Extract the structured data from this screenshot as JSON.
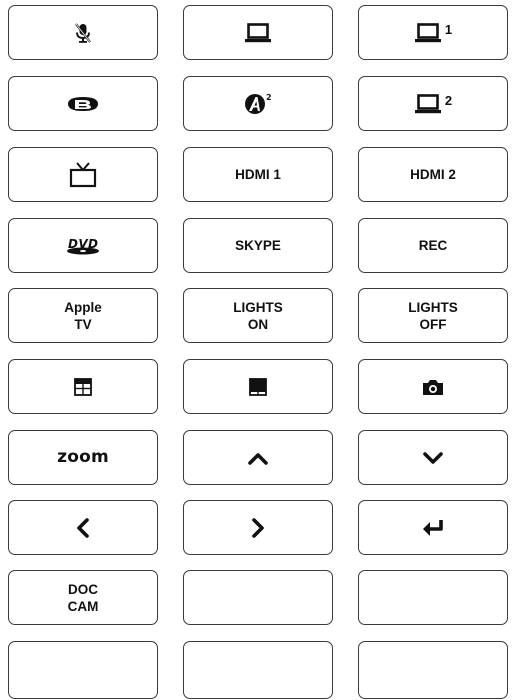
{
  "panel": {
    "buttons": [
      {
        "icon": "mic-muted-icon",
        "label": "",
        "suffix": ""
      },
      {
        "icon": "laptop-icon",
        "label": "",
        "suffix": ""
      },
      {
        "icon": "laptop-icon",
        "label": "",
        "suffix": "1"
      },
      {
        "icon": "bluray-icon",
        "label": "",
        "suffix": ""
      },
      {
        "icon": "airmedia-icon",
        "label": "",
        "suffix": ""
      },
      {
        "icon": "laptop-icon",
        "label": "",
        "suffix": "2"
      },
      {
        "icon": "tv-icon",
        "label": "",
        "suffix": ""
      },
      {
        "icon": "",
        "label": "HDMI 1",
        "suffix": ""
      },
      {
        "icon": "",
        "label": "HDMI 2",
        "suffix": ""
      },
      {
        "icon": "dvd-icon",
        "label": "",
        "suffix": ""
      },
      {
        "icon": "",
        "label": "SKYPE",
        "suffix": ""
      },
      {
        "icon": "",
        "label": "REC",
        "suffix": ""
      },
      {
        "icon": "",
        "label": "Apple\nTV",
        "suffix": ""
      },
      {
        "icon": "",
        "label": "LIGHTS\nON",
        "suffix": ""
      },
      {
        "icon": "",
        "label": "LIGHTS\nOFF",
        "suffix": ""
      },
      {
        "icon": "shade-up-icon",
        "label": "",
        "suffix": ""
      },
      {
        "icon": "shade-down-icon",
        "label": "",
        "suffix": ""
      },
      {
        "icon": "camera-icon",
        "label": "",
        "suffix": ""
      },
      {
        "icon": "zoom-logo",
        "label": "zoom",
        "suffix": ""
      },
      {
        "icon": "chevron-up-icon",
        "label": "",
        "suffix": ""
      },
      {
        "icon": "chevron-down-icon",
        "label": "",
        "suffix": ""
      },
      {
        "icon": "chevron-left-icon",
        "label": "",
        "suffix": ""
      },
      {
        "icon": "chevron-right-icon",
        "label": "",
        "suffix": ""
      },
      {
        "icon": "enter-icon",
        "label": "",
        "suffix": ""
      },
      {
        "icon": "",
        "label": "DOC\nCAM",
        "suffix": ""
      },
      {
        "icon": "",
        "label": "",
        "suffix": ""
      },
      {
        "icon": "",
        "label": "",
        "suffix": ""
      },
      {
        "icon": "",
        "label": "",
        "suffix": ""
      },
      {
        "icon": "",
        "label": "",
        "suffix": ""
      },
      {
        "icon": "",
        "label": "",
        "suffix": ""
      }
    ]
  }
}
